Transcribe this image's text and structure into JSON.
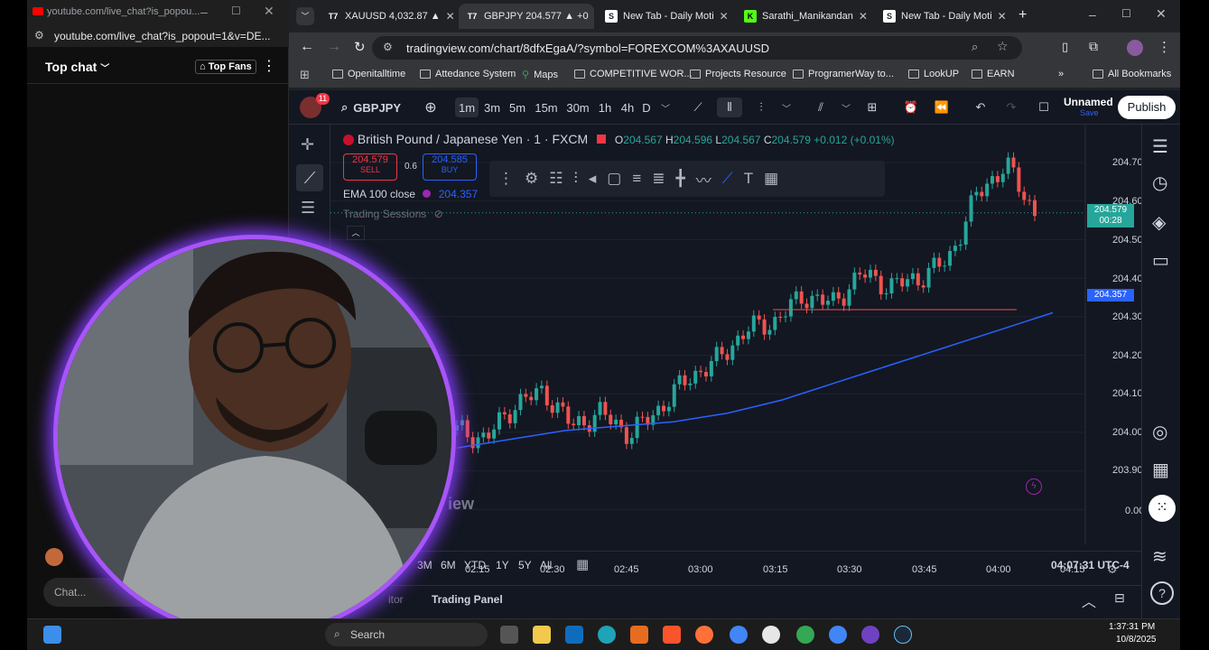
{
  "youtube_popup": {
    "title": "youtube.com/live_chat?is_popou...",
    "address": "youtube.com/live_chat?is_popout=1&v=DE...",
    "chat_header": "Top chat",
    "top_fans": "Top Fans",
    "chat_placeholder": "Chat..."
  },
  "browser": {
    "tabs": [
      {
        "label": "XAUUSD 4,032.87 ▲",
        "favicon": "TV",
        "color": "#e8eaed"
      },
      {
        "label": "GBPJPY 204.577 ▲ +0",
        "favicon": "TV",
        "color": "#e8eaed"
      },
      {
        "label": "New Tab - Daily Moti",
        "favicon": "S",
        "color": "#e8eaed"
      },
      {
        "label": "Sarathi_Manikandan",
        "favicon": "K",
        "color": "#e8eaed"
      },
      {
        "label": "New Tab - Daily Moti",
        "favicon": "S",
        "color": "#e8eaed"
      }
    ],
    "url": "tradingview.com/chart/8dfxEgaA/?symbol=FOREXCOM%3AXAUUSD",
    "bookmarks": [
      "Openitalltime",
      "Attedance System",
      "Maps",
      "COMPETITIVE WOR...",
      "Projects Resource",
      "ProgramerWay to...",
      "LookUP",
      "EARN"
    ],
    "all_bookmarks": "All Bookmarks"
  },
  "tv": {
    "notif_count": "11",
    "symbol": "GBPJPY",
    "intervals": [
      "1m",
      "3m",
      "5m",
      "15m",
      "30m",
      "1h",
      "4h",
      "D"
    ],
    "active_interval": "1m",
    "layout_name": "Unnamed",
    "layout_status": "Save",
    "publish": "Publish",
    "title": "British Pound / Japanese Yen · 1 · FXCM",
    "ohlc": {
      "o_label": "O",
      "o": "204.567",
      "h_label": "H",
      "h": "204.596",
      "l_label": "L",
      "l": "204.567",
      "c_label": "C",
      "c": "204.579",
      "change": "+0.012 (+0.01%)"
    },
    "sell_price": "204.579",
    "sell_label": "SELL",
    "spread": "0.6",
    "buy_price": "204.585",
    "buy_label": "BUY",
    "ema_label": "EMA 100 close",
    "ema_value": "204.357",
    "sessions_label": "Trading Sessions",
    "watermark": "iew",
    "price_axis": [
      "204.700",
      "204.600",
      "204.500",
      "204.400",
      "204.300",
      "204.200",
      "204.100",
      "204.000",
      "203.900",
      "0.00"
    ],
    "last_price_tag": "204.579",
    "countdown": "00:28",
    "ema_tag": "204.357",
    "time_axis": [
      "02:15",
      "02:30",
      "02:45",
      "03:00",
      "03:15",
      "03:30",
      "03:45",
      "04:00",
      "04:15"
    ],
    "ranges": [
      "3M",
      "6M",
      "YTD",
      "1Y",
      "5Y",
      "All"
    ],
    "clock": "04:07:31 UTC-4",
    "bottom_tabs": [
      "itor",
      "Trading Panel"
    ],
    "colors": {
      "up": "#26a69a",
      "down": "#ef5350",
      "ema": "#2962ff",
      "bg": "#131722"
    }
  },
  "taskbar": {
    "search": "Search",
    "time": "1:37:31 PM",
    "date": "10/8/2025"
  },
  "chart_data": {
    "type": "candlestick",
    "series": [
      {
        "name": "EMA 100 close",
        "values": [
          204.04,
          204.06,
          204.08,
          204.09,
          204.1,
          204.12,
          204.15,
          204.19,
          204.23,
          204.27,
          204.31,
          204.35
        ]
      }
    ],
    "close": [
      204.08,
      204.06,
      204.14,
      204.17,
      204.09,
      204.12,
      204.07,
      204.13,
      204.2,
      204.24,
      204.31,
      204.33,
      204.39,
      204.37,
      204.44,
      204.41,
      204.43,
      204.47,
      204.62,
      204.69,
      204.58
    ],
    "x_range": [
      "02:08",
      "04:07"
    ],
    "ylim": [
      203.85,
      204.74
    ]
  }
}
